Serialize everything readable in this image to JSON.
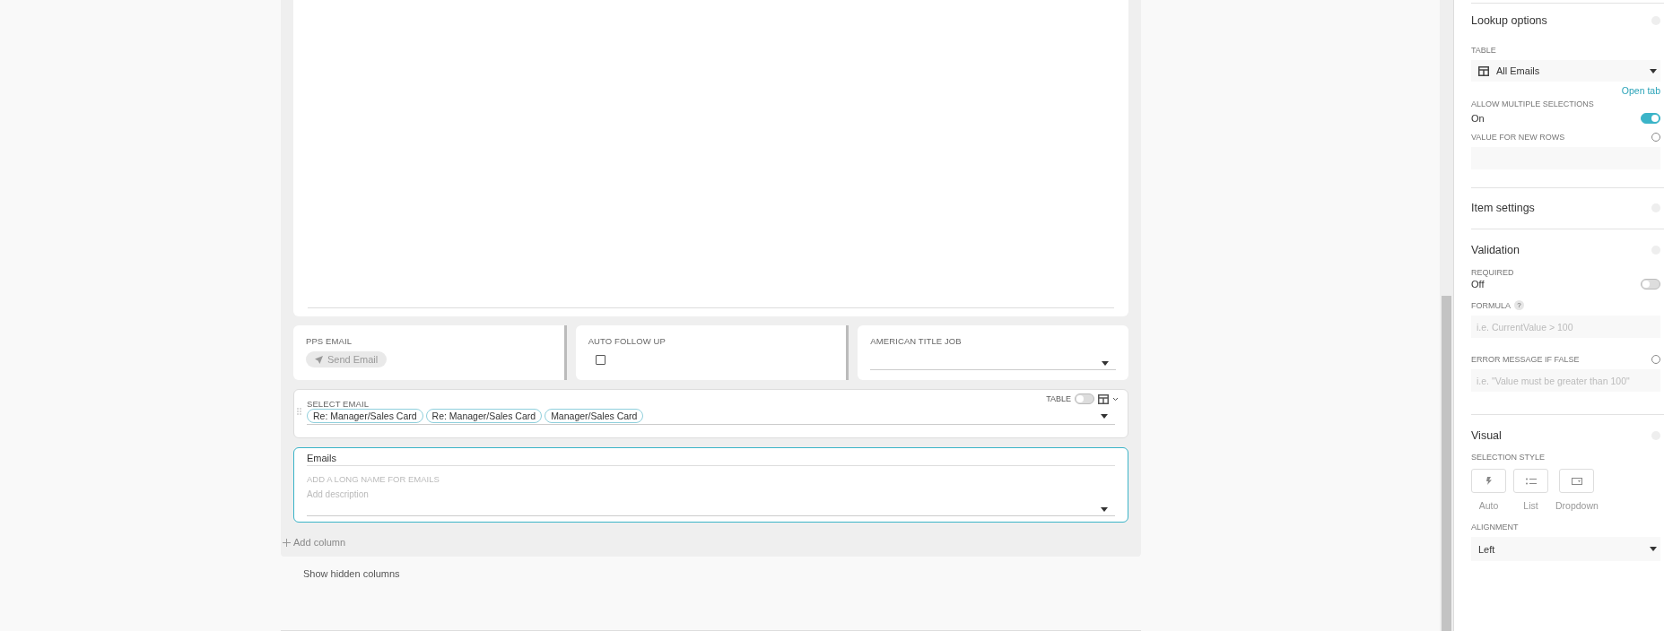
{
  "fields": [
    {
      "kind": "button",
      "label": "PPS EMAIL",
      "button": "Send Email"
    },
    {
      "kind": "checkbox",
      "label": "AUTO FOLLOW UP",
      "checked": false
    },
    {
      "kind": "dropdown",
      "label": "AMERICAN TITLE JOB"
    }
  ],
  "select_field": {
    "label": "SELECT EMAIL",
    "table_label": "TABLE",
    "table_on": false,
    "tags": [
      "Re: Manager/Sales Card",
      "Re: Manager/Sales Card",
      "Manager/Sales Card"
    ]
  },
  "new_column": {
    "name": "Emails",
    "long_name_placeholder": "ADD A LONG NAME FOR EMAILS",
    "description_placeholder": "Add description"
  },
  "add_column": "Add column",
  "show_hidden": "Show hidden columns",
  "lookup": {
    "title": "Lookup options",
    "table_label": "TABLE",
    "table_value": "All Emails",
    "open_link": "Open tab",
    "multiple_label": "ALLOW MULTIPLE SELECTIONS",
    "multiple_value": "On",
    "multiple_on": true,
    "new_rows_label": "VALUE FOR NEW ROWS"
  },
  "item_settings": {
    "title": "Item settings"
  },
  "validation": {
    "title": "Validation",
    "required_label": "REQUIRED",
    "required_value": "Off",
    "required_on": false,
    "formula_label": "FORMULA",
    "formula_help": "?",
    "formula_placeholder": "i.e. CurrentValue > 100",
    "error_label": "ERROR MESSAGE IF FALSE",
    "error_placeholder": "i.e. \"Value must be greater than 100\""
  },
  "visual": {
    "title": "Visual",
    "style_label": "SELECTION STYLE",
    "styles": [
      {
        "kind": "auto",
        "label": "Auto",
        "selected": false
      },
      {
        "kind": "list",
        "label": "List",
        "selected": false
      },
      {
        "kind": "dropdown",
        "label": "Dropdown",
        "selected": false
      }
    ],
    "alignment_label": "ALIGNMENT",
    "alignment_value": "Left"
  }
}
